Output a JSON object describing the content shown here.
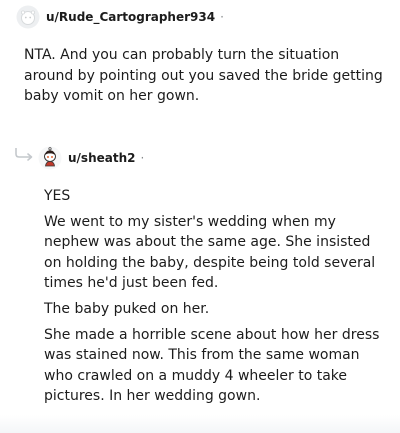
{
  "colors": {
    "text": "#1c1c1c",
    "meta": "#878a8c",
    "thread_line": "#c4c8cc"
  },
  "comments": [
    {
      "author": "u/Rude_Cartographer934",
      "separator": "·",
      "avatar_icon": "default-avatar-icon",
      "paragraphs": [
        "NTA. And you can probably turn the situation around by pointing out you saved the bride getting baby vomit on her gown."
      ]
    },
    {
      "author": "u/sheath2",
      "separator": "·",
      "avatar_icon": "snoo-avatar-icon",
      "reply_icon": "reply-arrow-icon",
      "paragraphs": [
        "YES",
        "We went to my sister's wedding when my nephew was about the same age. She insisted on holding the baby, despite being told several times he'd just been fed.",
        "The baby puked on her.",
        "She made a horrible scene about how her dress was stained now. This from the same woman who crawled on a muddy 4 wheeler to take pictures. In her wedding gown."
      ]
    }
  ]
}
